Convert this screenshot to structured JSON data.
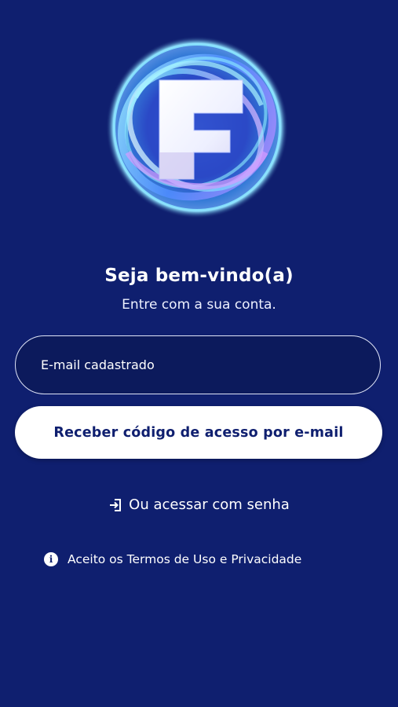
{
  "logo": {
    "icon": "app-logo-f",
    "letter": "F"
  },
  "welcome": {
    "title": "Seja bem-vindo(a)",
    "subtitle": "Entre com a sua conta."
  },
  "form": {
    "email_placeholder": "E-mail cadastrado",
    "email_value": "",
    "submit_label": "Receber código de acesso por e-mail"
  },
  "alt_login": {
    "icon": "login-arrow-icon",
    "label": "Ou acessar com senha"
  },
  "terms": {
    "icon": "info-icon",
    "icon_glyph": "i",
    "label": "Aceito os Termos de Uso e Privacidade"
  },
  "colors": {
    "background": "#0f1f6f",
    "button_bg": "#ffffff",
    "button_text": "#0f1f6f",
    "text": "#ffffff"
  }
}
